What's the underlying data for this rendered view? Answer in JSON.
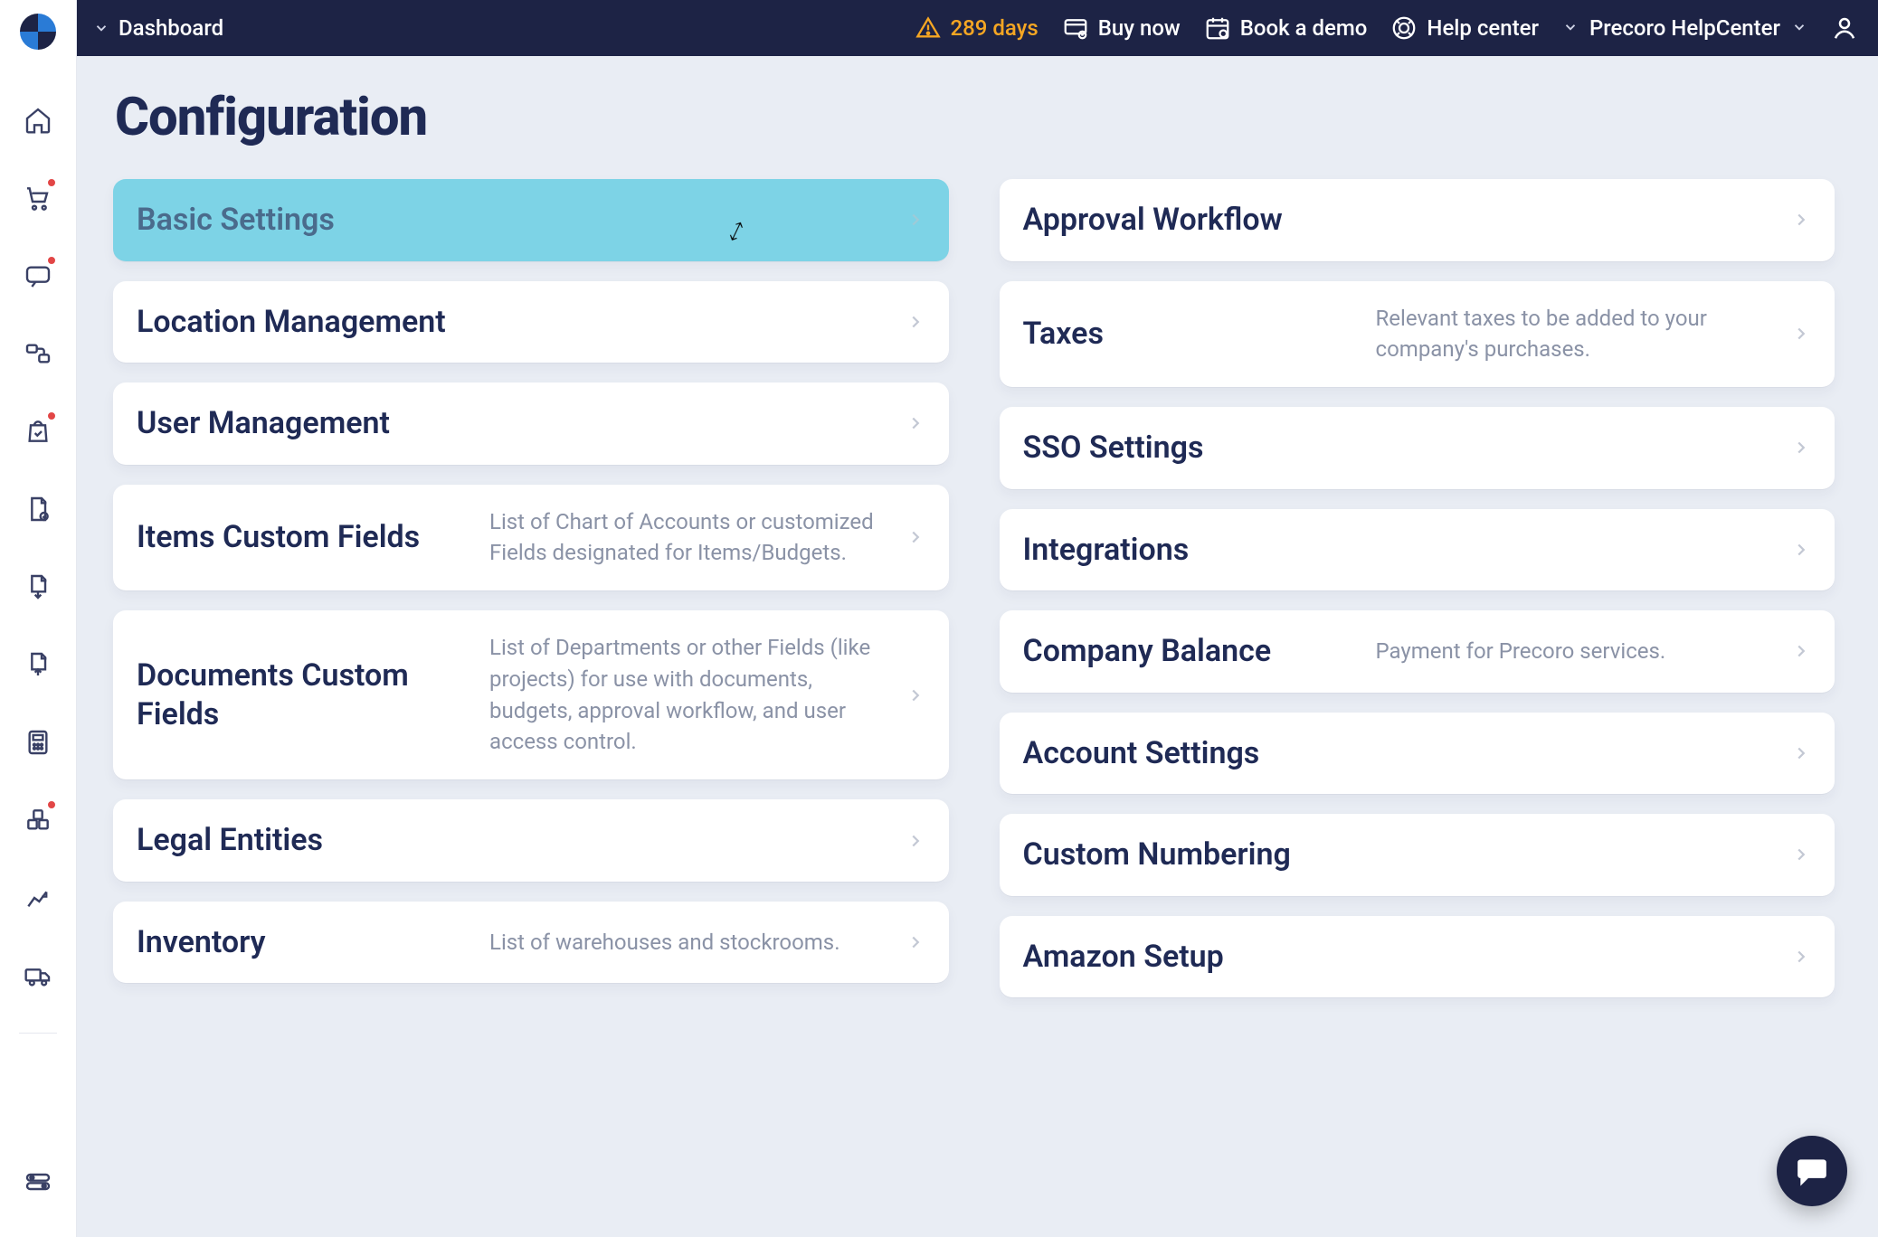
{
  "header": {
    "breadcrumb": "Dashboard",
    "trial_days": "289 days",
    "buy_now": "Buy now",
    "book_demo": "Book a demo",
    "help_center": "Help center",
    "org_name": "Precoro HelpCenter"
  },
  "sidebar": {
    "items": [
      {
        "name": "home",
        "badge": false
      },
      {
        "name": "cart",
        "badge": true
      },
      {
        "name": "requests",
        "badge": true
      },
      {
        "name": "approvals",
        "badge": false
      },
      {
        "name": "orders",
        "badge": true
      },
      {
        "name": "invoices",
        "badge": false
      },
      {
        "name": "receipts",
        "badge": false
      },
      {
        "name": "payments",
        "badge": false
      },
      {
        "name": "budgets",
        "badge": false
      },
      {
        "name": "inventory",
        "badge": true
      },
      {
        "name": "reports",
        "badge": false
      },
      {
        "name": "shipping",
        "badge": false
      }
    ],
    "bottom_item": {
      "name": "settings-toggle"
    }
  },
  "page": {
    "title": "Configuration"
  },
  "cards_left": [
    {
      "title": "Basic Settings",
      "desc": "",
      "active": true
    },
    {
      "title": "Location Management",
      "desc": ""
    },
    {
      "title": "User Management",
      "desc": ""
    },
    {
      "title": "Items Custom Fields",
      "desc": "List of Chart of Accounts or customized Fields designated for Items/Budgets."
    },
    {
      "title": "Documents Custom Fields",
      "desc": "List of Departments or other Fields (like projects) for use with documents, budgets, approval workflow, and user access control."
    },
    {
      "title": "Legal Entities",
      "desc": ""
    },
    {
      "title": "Inventory",
      "desc": "List of warehouses and stockrooms."
    }
  ],
  "cards_right": [
    {
      "title": "Approval Workflow",
      "desc": ""
    },
    {
      "title": "Taxes",
      "desc": "Relevant taxes to be added to your company's purchases."
    },
    {
      "title": "SSO Settings",
      "desc": ""
    },
    {
      "title": "Integrations",
      "desc": ""
    },
    {
      "title": "Company Balance",
      "desc": "Payment for Precoro services."
    },
    {
      "title": "Account Settings",
      "desc": ""
    },
    {
      "title": "Custom Numbering",
      "desc": ""
    },
    {
      "title": "Amazon Setup",
      "desc": ""
    }
  ]
}
